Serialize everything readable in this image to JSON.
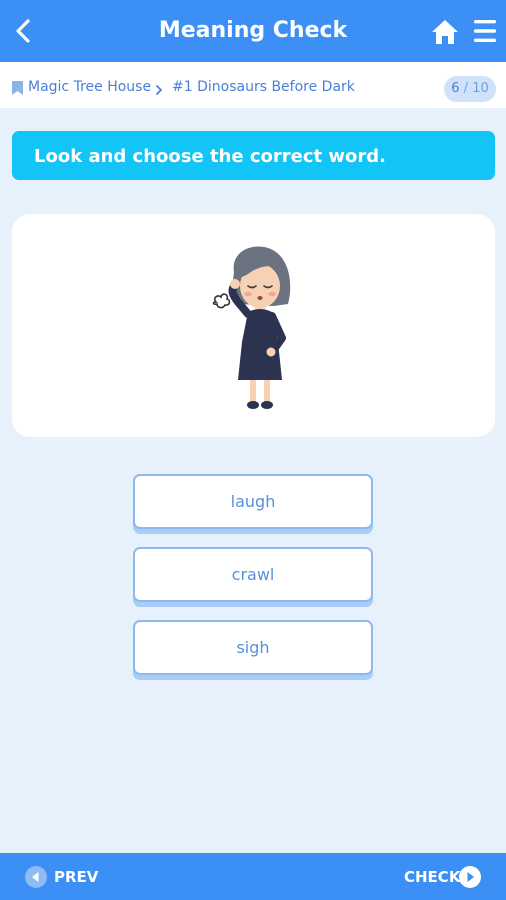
{
  "header": {
    "title": "Meaning Check",
    "back_icon": "chevron-left-icon",
    "home_icon": "home-icon",
    "menu_icon": "hamburger-menu-icon"
  },
  "breadcrumb": {
    "book": "Magic Tree House",
    "chapter": "#1 Dinosaurs Before Dark",
    "progress_current": "6",
    "progress_separator": "/",
    "progress_total": "10"
  },
  "instruction": "Look and choose the correct word.",
  "image": {
    "description_icon": "woman-sighing-illustration"
  },
  "options": [
    {
      "label": "laugh"
    },
    {
      "label": "crawl"
    },
    {
      "label": "sigh"
    }
  ],
  "footer": {
    "prev_label": "PREV",
    "check_label": "CHECK"
  },
  "colors": {
    "primary": "#3b8ff5",
    "instruction_bg": "#13c4f6",
    "page_bg": "#e7f1fb",
    "option_border": "#8cbaf0"
  }
}
